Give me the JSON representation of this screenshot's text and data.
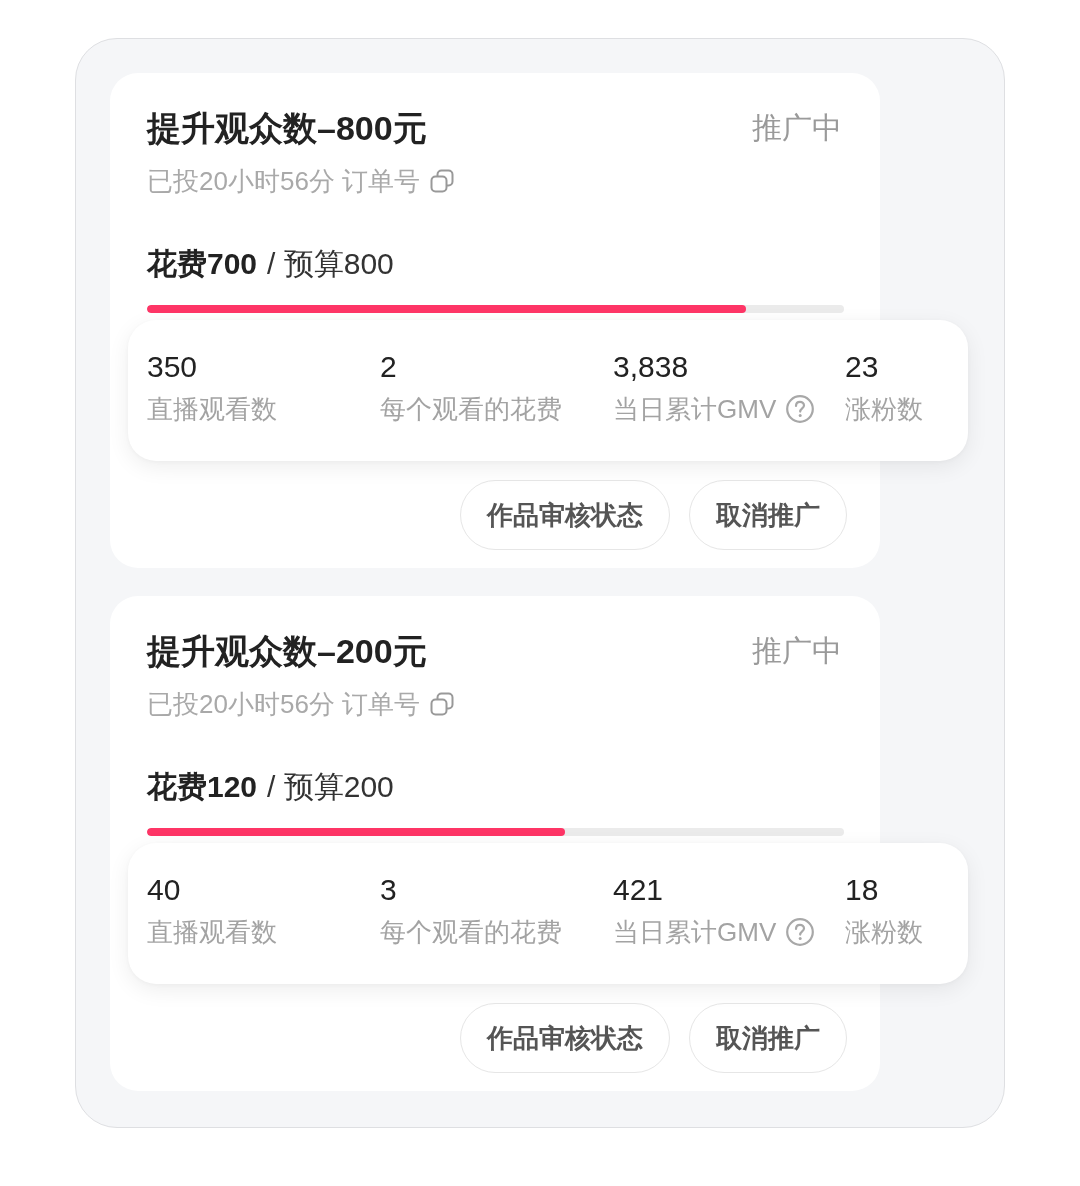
{
  "campaigns": [
    {
      "title": "提升观众数–800元",
      "status": "推广中",
      "subtitle": "已投20小时56分 订单号",
      "spent": "花费700",
      "budget": "/ 预算800",
      "level": 0.86,
      "stats": [
        {
          "value": "350",
          "label": "直播观看数",
          "help": false
        },
        {
          "value": "2",
          "label": "每个观看的花费",
          "help": false
        },
        {
          "value": "3,838",
          "label": "当日累计GMV",
          "help": true
        },
        {
          "value": "23",
          "label": "涨粉数",
          "help": false
        }
      ],
      "buttons": [
        "作品审核状态",
        "取消推广"
      ]
    },
    {
      "title": "提升观众数–200元",
      "status": "推广中",
      "subtitle": "已投20小时56分 订单号",
      "spent": "花费120",
      "budget": "/ 预算200",
      "level": 0.6,
      "stats": [
        {
          "value": "40",
          "label": "直播观看数",
          "help": false
        },
        {
          "value": "3",
          "label": "每个观看的花费",
          "help": false
        },
        {
          "value": "421",
          "label": "当日累计GMV",
          "help": true
        },
        {
          "value": "18",
          "label": "涨粉数",
          "help": false
        }
      ],
      "buttons": [
        "作品审核状态",
        "取消推广"
      ]
    }
  ]
}
